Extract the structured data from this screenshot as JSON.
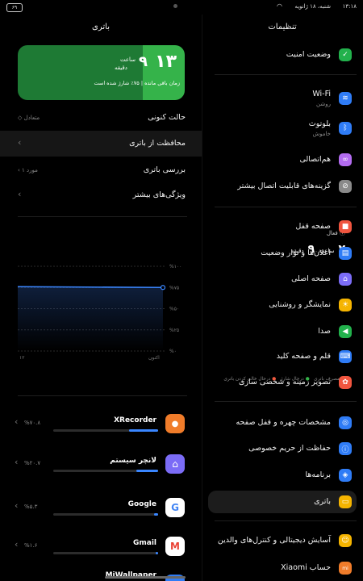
{
  "status_bar": {
    "time": "۱۳:۱۸",
    "date": "شنبه، ۱۸ ژانویه",
    "battery_badge": "۶۹"
  },
  "settings": {
    "title": "تنظیمات",
    "items": [
      {
        "label": "وضعیت امنیت",
        "sub": "",
        "icon": "shield-check-icon",
        "color": "#22b14c"
      },
      {
        "label": "Wi-Fi",
        "sub": "روشن",
        "icon": "wifi-icon",
        "color": "#2f7cf6"
      },
      {
        "label": "بلوتوث",
        "sub": "خاموش",
        "icon": "bluetooth-icon",
        "color": "#2f7cf6"
      },
      {
        "label": "هم‌اتصالی",
        "sub": "",
        "icon": "share-icon",
        "color": "#b36cf0"
      },
      {
        "label": "گزینه‌های قابلیت اتصال بیشتر",
        "sub": "",
        "icon": "link-icon",
        "color": "#8a8a8a"
      },
      {
        "label": "صفحه قفل",
        "sub": "",
        "icon": "lock-icon",
        "color": "#f0553f"
      },
      {
        "label": "اعلان‌ها و نوار وضعیت",
        "sub": "",
        "icon": "notification-icon",
        "color": "#2f7cf6"
      },
      {
        "label": "صفحه اصلی",
        "sub": "",
        "icon": "home-icon",
        "color": "#7b6cf6"
      },
      {
        "label": "نمایشگر و روشنایی",
        "sub": "",
        "icon": "sun-icon",
        "color": "#f5b400"
      },
      {
        "label": "صدا",
        "sub": "",
        "icon": "speaker-icon",
        "color": "#22b14c"
      },
      {
        "label": "قلم و صفحه کلید",
        "sub": "",
        "icon": "keyboard-icon",
        "color": "#2f7cf6"
      },
      {
        "label": "تصویر زمینه و شخصی سازی",
        "sub": "",
        "icon": "palette-icon",
        "color": "#f0553f"
      },
      {
        "label": "مشخصات چهره و قفل صفحه",
        "sub": "",
        "icon": "face-id-icon",
        "color": "#2f7cf6"
      },
      {
        "label": "حفاظت از حریم خصوصی",
        "sub": "",
        "icon": "privacy-icon",
        "color": "#2f7cf6"
      },
      {
        "label": "برنامه‌ها",
        "sub": "",
        "icon": "apps-icon",
        "color": "#2f7cf6"
      },
      {
        "label": "باتری",
        "sub": "",
        "icon": "battery-icon",
        "color": "#f5b400"
      },
      {
        "label": "آسایش دیجیتالی و کنترل‌های والدین",
        "sub": "",
        "icon": "wellbeing-icon",
        "color": "#f5b400"
      },
      {
        "label": "حساب Xiaomi",
        "sub": "",
        "icon": "mi-account-icon",
        "color": "#f07c2a"
      }
    ]
  },
  "battery": {
    "title": "باتری",
    "card": {
      "hours": "۱۳",
      "minutes": "۹",
      "hours_unit": "ساعت",
      "minutes_unit": "دقیقه",
      "remaining_text": "زمان باقی مانده | ۷۵٪ شارژ شده است",
      "color_bright": "#35b34a",
      "color_dark": "#1e7a34"
    },
    "current_mode_label": "حالت کنونی",
    "current_mode_value": "متعادل",
    "protection_label": "محافظت از باتری",
    "check_label": "بررسی باتری",
    "check_value": "۱ مورد",
    "more_label": "ویژگی‌های بیشتر",
    "usage": {
      "active_label": "فعال",
      "hours": "۲",
      "hours_unit": "ساعت",
      "minutes": "۹",
      "minutes_unit": "دقیقه",
      "legend": [
        "مصرف باتری",
        "درحال شارژ",
        "درحال خالی کردن باتری"
      ],
      "x_left": "۱۲",
      "x_right": "اکنون"
    },
    "apps": [
      {
        "name": "XRecorder",
        "percent": "%۷۰.۸",
        "icon": "xrecorder-icon",
        "fill": 0.28
      },
      {
        "name": "لانچر سیستم",
        "percent": "%۲۰.۷",
        "icon": "system-launcher-icon",
        "fill": 0.21
      },
      {
        "name": "Google",
        "percent": "%۵.۳",
        "icon": "google-icon",
        "fill": 0.04
      },
      {
        "name": "Gmail",
        "percent": "%۱.۶",
        "icon": "gmail-icon",
        "fill": 0.02
      },
      {
        "name": "MiWallpaper",
        "percent": "",
        "icon": "miwallpaper-icon",
        "fill": 0.0
      }
    ]
  },
  "chart_data": {
    "type": "line",
    "y_ticks": [
      "%۱۰۰",
      "%۷۵",
      "%۵۰",
      "%۲۵",
      "%۰"
    ],
    "x_ticks": [
      "۱۲",
      "اکنون"
    ],
    "ylim": [
      0,
      100
    ],
    "series": [
      {
        "name": "مصرف باتری",
        "values": [
          76,
          75
        ]
      }
    ],
    "legend": [
      "مصرف باتری",
      "درحال شارژ",
      "درحال خالی کردن باتری"
    ]
  }
}
